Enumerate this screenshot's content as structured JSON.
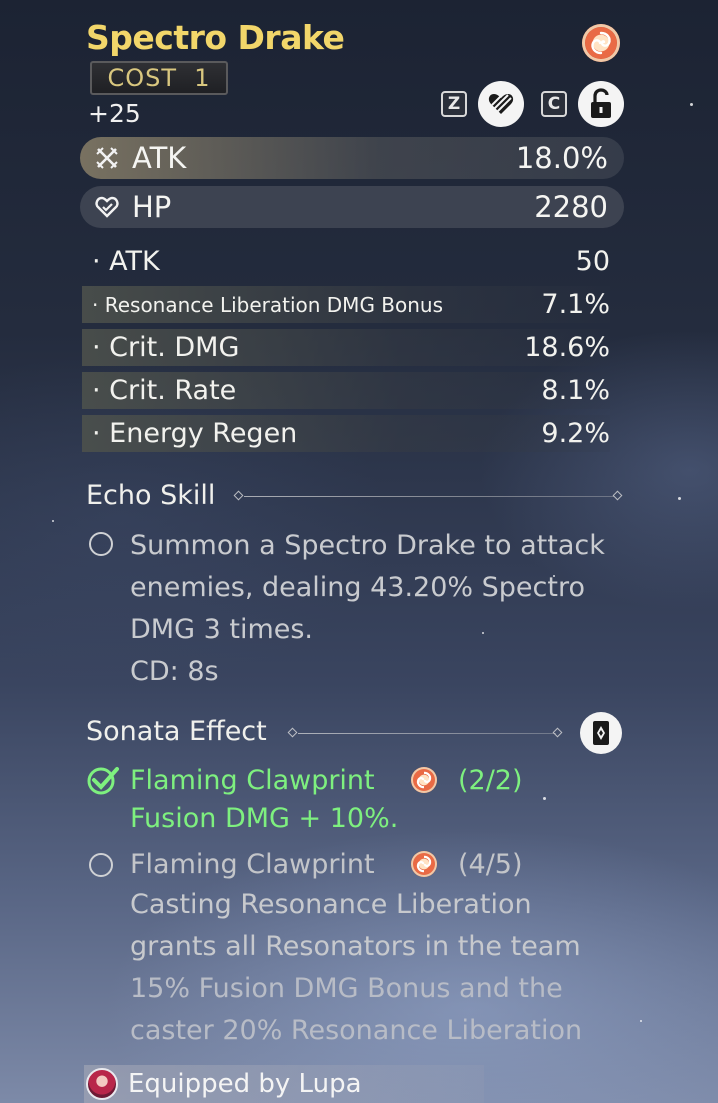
{
  "echo": {
    "name": "Spectro Drake",
    "cost_label": "COST",
    "cost_value": "1",
    "level": "+25"
  },
  "controls": {
    "discard_key": "Z",
    "lock_key": "C",
    "discard_icon": "discard-heart-icon",
    "lock_icon": "unlock-icon"
  },
  "main_stats": [
    {
      "icon": "sword-icon",
      "label": "ATK",
      "value": "18.0%"
    },
    {
      "icon": "heart-icon",
      "label": "HP",
      "value": "2280"
    }
  ],
  "sub_stats": [
    {
      "label": "· ATK",
      "value": "50"
    },
    {
      "label": "· Resonance Liberation DMG Bonus",
      "value": "7.1%"
    },
    {
      "label": "· Crit. DMG",
      "value": "18.6%"
    },
    {
      "label": "· Crit. Rate",
      "value": "8.1%"
    },
    {
      "label": "· Energy Regen",
      "value": "9.2%"
    }
  ],
  "echo_skill": {
    "title": "Echo Skill",
    "line1": "Summon a Spectro Drake to attack",
    "line2": "enemies, dealing 43.20% Spectro",
    "line3": "DMG 3 times.",
    "cd": "CD: 8s"
  },
  "sonata": {
    "title": "Sonata Effect",
    "set1": {
      "name": "Flaming Clawprint",
      "progress": "(2/2)",
      "effect": "Fusion DMG + 10%."
    },
    "set2": {
      "name": "Flaming Clawprint",
      "progress": "(4/5)",
      "line1": "Casting Resonance Liberation",
      "line2": "grants all Resonators in the team",
      "line3": "15% Fusion DMG Bonus and the",
      "line4": "caster 20% Resonance Liberation"
    }
  },
  "equipped": "Equipped by Lupa",
  "colors": {
    "title": "#f2d66a",
    "active_set": "#7ef07f",
    "sonata_orange": "#e96a45"
  }
}
